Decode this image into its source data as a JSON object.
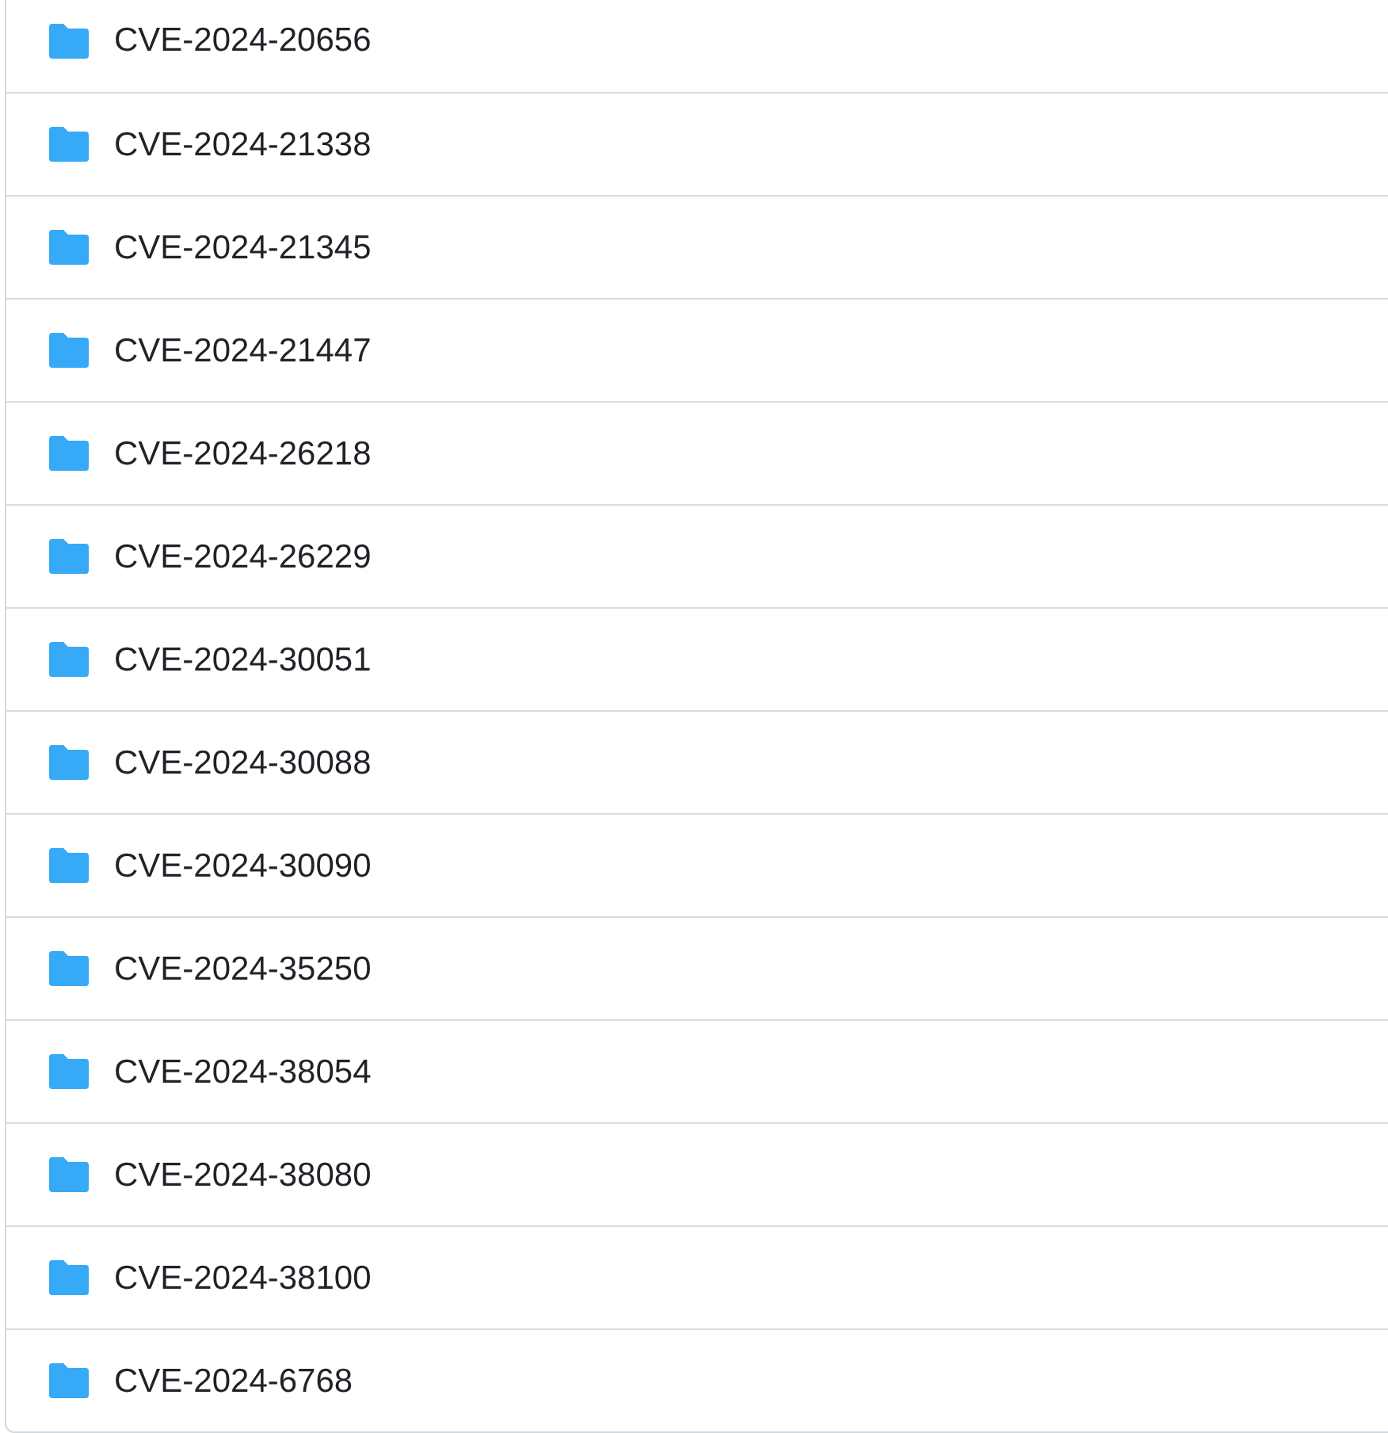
{
  "folders": [
    {
      "name": "CVE-2024-20656"
    },
    {
      "name": "CVE-2024-21338"
    },
    {
      "name": "CVE-2024-21345"
    },
    {
      "name": "CVE-2024-21447"
    },
    {
      "name": "CVE-2024-26218"
    },
    {
      "name": "CVE-2024-26229"
    },
    {
      "name": "CVE-2024-30051"
    },
    {
      "name": "CVE-2024-30088"
    },
    {
      "name": "CVE-2024-30090"
    },
    {
      "name": "CVE-2024-35250"
    },
    {
      "name": "CVE-2024-38054"
    },
    {
      "name": "CVE-2024-38080"
    },
    {
      "name": "CVE-2024-38100"
    },
    {
      "name": "CVE-2024-6768"
    }
  ]
}
